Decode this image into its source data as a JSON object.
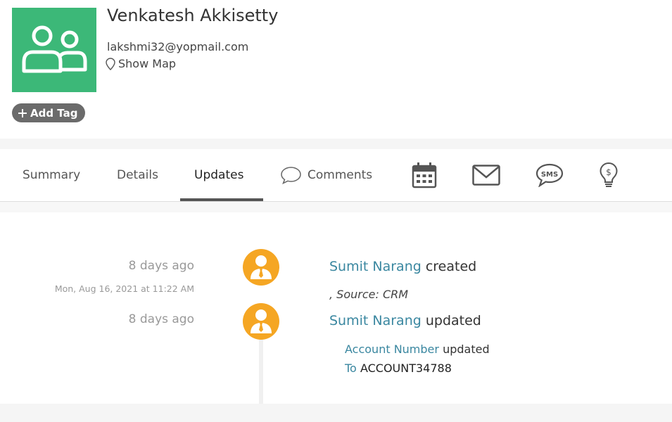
{
  "contact": {
    "name": "Venkatesh Akkisetty",
    "email": "lakshmi32@yopmail.com",
    "show_map": "Show Map",
    "add_tag": "Add Tag",
    "avatar_icon": "contacts-icon",
    "avatar_color": "#3cb878"
  },
  "tabs": [
    {
      "label": "Summary",
      "active": false
    },
    {
      "label": "Details",
      "active": false
    },
    {
      "label": "Updates",
      "active": true
    },
    {
      "label": "Comments",
      "active": false,
      "icon": "comment-icon"
    }
  ],
  "tab_icons": [
    "calendar-icon",
    "email-icon",
    "sms-icon",
    "lightbulb-icon"
  ],
  "timeline": [
    {
      "relative_time": "8 days ago",
      "absolute_time": "Mon, Aug 16, 2021 at 11:22 AM",
      "user": "Sumit Narang",
      "action": "created",
      "source": ", Source: CRM"
    },
    {
      "relative_time": "8 days ago",
      "user": "Sumit Narang",
      "action": "updated",
      "field": "Account Number",
      "field_action": "updated",
      "to_label": "To",
      "to_value": "ACCOUNT34788"
    }
  ],
  "colors": {
    "accent_link": "#3a87a0",
    "timeline_avatar": "#f5a623"
  }
}
